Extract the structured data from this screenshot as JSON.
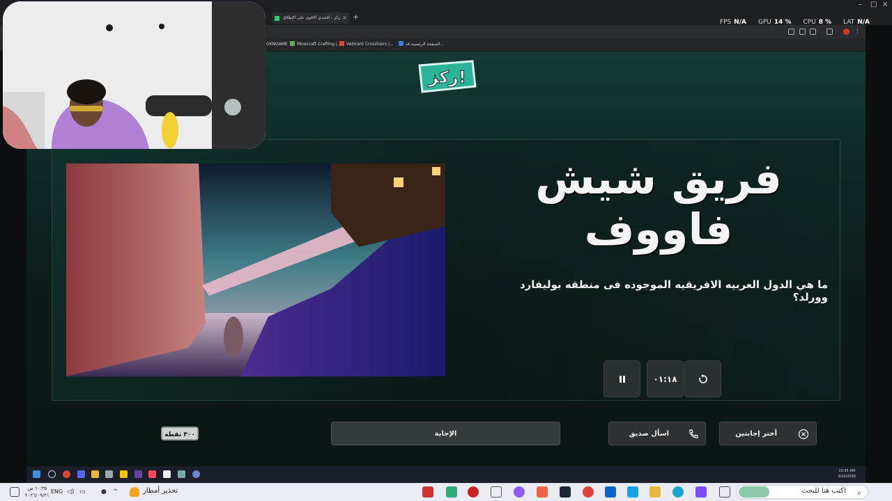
{
  "browser": {
    "tabs": [
      {
        "label": "ركز - التحدي الاقوى على الإطلاق"
      }
    ],
    "bookmarks": [
      {
        "label": "OXNGAME"
      },
      {
        "label": "Minecraft Crafting |..."
      },
      {
        "label": "Valorant Crosshairs |..."
      },
      {
        "label": "الصفحة الرئيسية قد..."
      }
    ]
  },
  "perf_overlay": {
    "fps_label": "FPS",
    "fps_value": "N/A",
    "gpu_label": "GPU",
    "gpu_value": "14 %",
    "cpu_label": "CPU",
    "cpu_value": "8 %",
    "lat_label": "LAT",
    "lat_value": "N/A"
  },
  "game": {
    "logo_text": "ركز!",
    "team_name": "فريق شيش فاووف",
    "question": "ما هي الدول العربيه الافريقيه الموجوده فى منطقه بوليفارد وورلد؟",
    "timer": "٠١:١٨",
    "controls": {
      "pause_icon": "pause-icon",
      "reset_icon": "rotate-icon"
    },
    "points": "٣٠٠ نقطة",
    "answer_label": "الإجابة",
    "ask_friend_label": "اسأل صديق",
    "choose_two_label": "أختر إجابتين",
    "accent_color": "#133a33"
  },
  "inner_taskbar": {
    "time": "10:35 AM",
    "date": "3/10/2026"
  },
  "os_taskbar": {
    "search_placeholder": "اكتب هنا للبحث",
    "weather_text": "تحذير أمطار",
    "lang": "ENG",
    "time": "١٠:٣٥ ص",
    "date": "٢٠٢٦/٠٩/٢١"
  }
}
